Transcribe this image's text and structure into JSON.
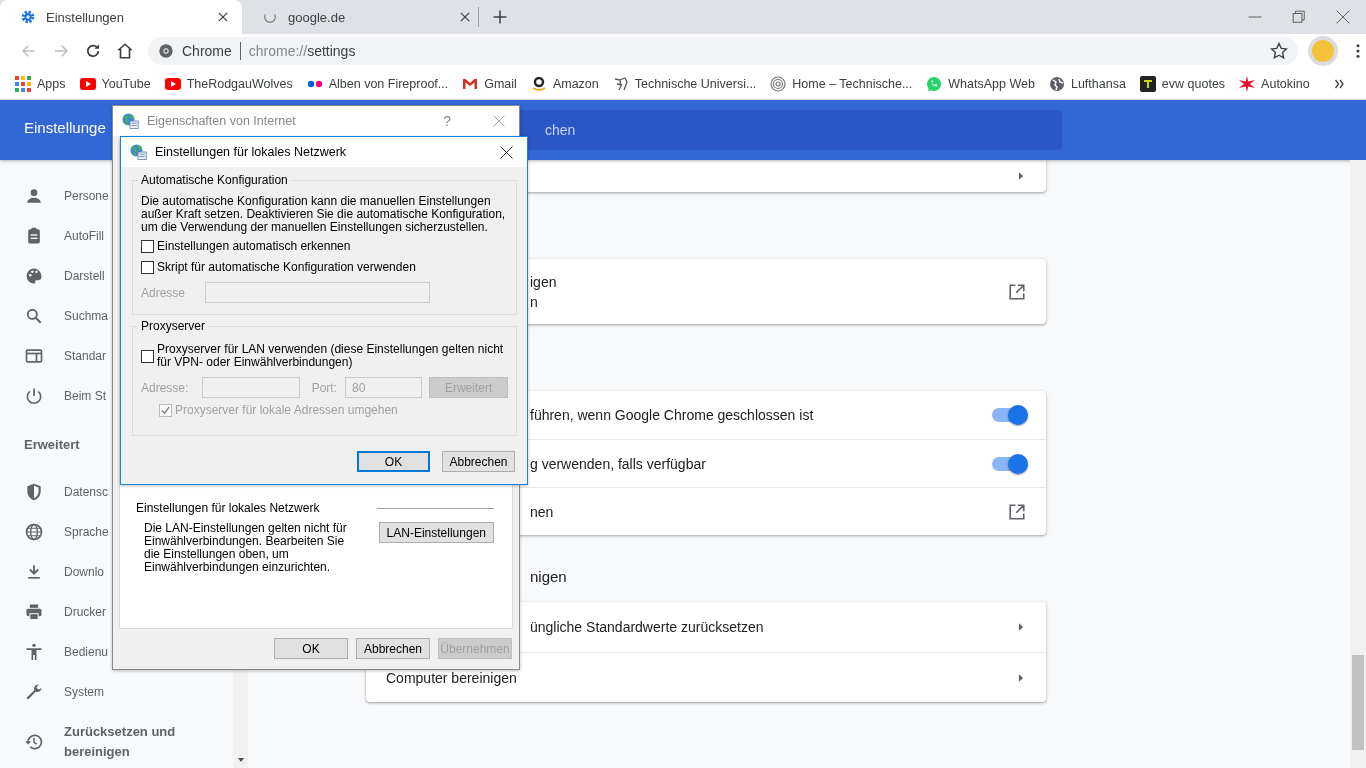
{
  "browser": {
    "tabs": [
      {
        "title": "Einstellungen",
        "kind": "settings",
        "selected": true
      },
      {
        "title": "google.de",
        "kind": "loading",
        "selected": false
      }
    ],
    "address": {
      "origin": "Chrome",
      "scheme": "chrome://",
      "path": "settings"
    },
    "bookmarks": [
      {
        "label": "Apps",
        "kind": "apps"
      },
      {
        "label": "YouTube",
        "kind": "youtube"
      },
      {
        "label": "TheRodgauWolves",
        "kind": "youtube"
      },
      {
        "label": "Alben von Fireproof...",
        "kind": "dots"
      },
      {
        "label": "Gmail",
        "kind": "mail"
      },
      {
        "label": "Amazon",
        "kind": "smile"
      },
      {
        "label": "Technische Universi...",
        "kind": "sketch"
      },
      {
        "label": "Home – Technische...",
        "kind": "fingerprint"
      },
      {
        "label": "WhatsApp Web",
        "kind": "chat"
      },
      {
        "label": "Lufthansa",
        "kind": "globe"
      },
      {
        "label": "evw quotes",
        "kind": "tile"
      },
      {
        "label": "Autokino",
        "kind": "star"
      }
    ]
  },
  "settings": {
    "title": "Einstellunge",
    "search_hint": "chen",
    "sidebar": [
      {
        "label": "Persone",
        "kind": "person"
      },
      {
        "label": "AutoFill",
        "kind": "clipboard"
      },
      {
        "label": "Darstell",
        "kind": "palette"
      },
      {
        "label": "Suchma",
        "kind": "search"
      },
      {
        "label": "Standar",
        "kind": "browser"
      },
      {
        "label": "Beim St",
        "kind": "power"
      },
      {
        "label": "Erweitert",
        "kind": "heading"
      },
      {
        "label": "Datensc",
        "kind": "shield"
      },
      {
        "label": "Sprache",
        "kind": "globe"
      },
      {
        "label": "Downlo",
        "kind": "download"
      },
      {
        "label": "Drucker",
        "kind": "printer"
      },
      {
        "label": "Bedienu",
        "kind": "accessibility"
      },
      {
        "label": "System",
        "kind": "wrench"
      },
      {
        "label": "Zurücksetzen und bereinigen",
        "kind": "history"
      }
    ],
    "sections": [
      {
        "kind": "card",
        "rows": [
          {
            "kind": "arrow",
            "lines": []
          }
        ]
      },
      {
        "kind": "card",
        "rows": [
          {
            "kind": "external",
            "lines": [
              "igen",
              "n"
            ],
            "partly_hidden": true
          }
        ]
      },
      {
        "kind": "card",
        "rows": [
          {
            "kind": "toggle",
            "lines": [
              "führen, wenn Google Chrome geschlossen ist"
            ],
            "on": true,
            "partly_hidden": true
          },
          {
            "kind": "toggle",
            "lines": [
              "g verwenden, falls verfügbar"
            ],
            "on": true,
            "partly_hidden": true
          },
          {
            "kind": "external",
            "lines": [
              "nen"
            ],
            "partly_hidden": true
          }
        ]
      },
      {
        "kind": "heading",
        "text": "nigen",
        "partly_hidden": true
      },
      {
        "kind": "card",
        "rows": [
          {
            "kind": "arrow",
            "lines": [
              "üngliche Standardwerte zurücksetzen"
            ],
            "partly_hidden": true
          },
          {
            "kind": "arrow",
            "lines": [
              "Computer bereinigen"
            ],
            "partly_hidden": false
          }
        ]
      }
    ]
  },
  "internet_options": {
    "title": "Eigenschaften von Internet",
    "help": "?",
    "lan_section": {
      "heading": "Einstellungen für lokales Netzwerk",
      "description": "Die LAN-Einstellungen gelten nicht für Einwählverbindungen. Bearbeiten Sie die Einstellungen oben, um Einwählverbindungen einzurichten.",
      "button": "LAN-Einstellungen"
    },
    "buttons": [
      {
        "label": "OK",
        "disabled": false
      },
      {
        "label": "Abbrechen",
        "disabled": false
      },
      {
        "label": "Übernehmen",
        "disabled": true
      }
    ]
  },
  "lan_dialog": {
    "title": "Einstellungen für lokales Netzwerk",
    "auto_config": {
      "legend": "Automatische Konfiguration",
      "description": "Die automatische Konfiguration kann die manuellen Einstellungen außer Kraft setzen. Deaktivieren Sie die automatische Konfiguration, um die Verwendung der manuellen Einstellungen sicherzustellen.",
      "options": [
        {
          "label": "Einstellungen automatisch erkennen",
          "checked": false,
          "disabled": false
        },
        {
          "label": "Skript für automatische Konfiguration verwenden",
          "checked": false,
          "disabled": false
        }
      ],
      "address": {
        "label": "Adresse",
        "disabled": true
      }
    },
    "proxy": {
      "legend": "Proxyserver",
      "use_proxy": {
        "label": "Proxyserver für LAN verwenden (diese Einstellungen gelten nicht für VPN- oder Einwählverbindungen)",
        "checked": false,
        "disabled": false
      },
      "address": {
        "label": "Adresse:",
        "disabled": true
      },
      "port": {
        "label": "Port:",
        "value": "80",
        "disabled": true
      },
      "advanced": {
        "label": "Erweitert",
        "disabled": true
      },
      "bypass_local": {
        "label": "Proxyserver für lokale Adressen umgehen",
        "checked": true,
        "disabled": true
      }
    },
    "buttons": [
      {
        "label": "OK",
        "focused": true
      },
      {
        "label": "Abbrechen",
        "focused": false
      }
    ]
  }
}
